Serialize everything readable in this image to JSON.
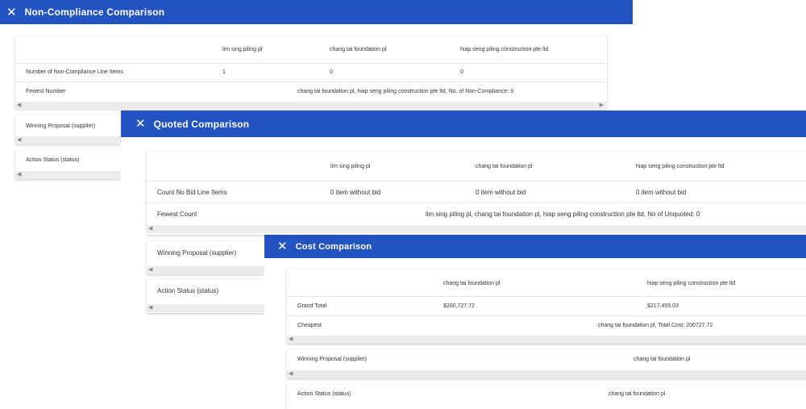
{
  "non_compliance": {
    "title": "Non-Compliance Comparison",
    "suppliers": [
      "lim sing piling pl",
      "chang tai foundation pl",
      "hiap seng piling construction pte ltd"
    ],
    "line_items_label": "Number of Non-Compliance Line Items",
    "line_items_values": [
      "1",
      "0",
      "0"
    ],
    "fewest_label": "Fewest Number",
    "fewest_value": "chang tai foundation pl, hiap seng piling construction pte ltd, No. of Non-Compliance: 0",
    "winning_label": "Winning Proposal (supplier)",
    "action_label": "Action Status (status)"
  },
  "quoted": {
    "title": "Quoted Comparison",
    "suppliers": [
      "lim sing piling pl",
      "chang tai foundation pl",
      "hiap seng piling construction pte ltd"
    ],
    "nobid_label": "Count No Bid Line Items",
    "nobid_values": [
      "0 item without bid",
      "0 item without bid",
      "0 item without bid"
    ],
    "fewest_label": "Fewest Count",
    "fewest_value": "lim sing piling pl, chang tai foundation pl, hiap seng piling construction pte ltd, No of Unquoted: 0",
    "winning_label": "Winning Proposal (supplier)",
    "action_label": "Action Status (status)"
  },
  "cost": {
    "title": "Cost Comparison",
    "suppliers": [
      "chang tai foundation pl",
      "hiap seng piling construction pte ltd"
    ],
    "grand_total_label": "Grand Total",
    "grand_total_values": [
      "$200,727.72",
      "$217,455.03"
    ],
    "cheapest_label": "Cheapest",
    "cheapest_value": "chang tai foundation pl, Total Cost: 200727.72",
    "winning_label": "Winning Proposal (supplier)",
    "winning_value": "chang tai foundation pl",
    "action_label": "Action Status (status)",
    "action_value": "chang tai foundation pl"
  },
  "icons": {
    "close": "close-icon",
    "scroll_left": "scroll-left-icon",
    "scroll_right": "scroll-right-icon"
  },
  "colors": {
    "header": "#2353c0",
    "scrollbar": "#ececec"
  }
}
